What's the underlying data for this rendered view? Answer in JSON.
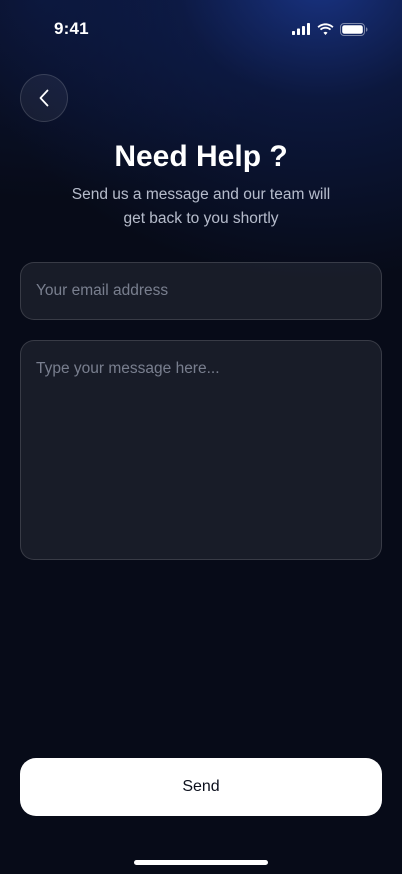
{
  "status_bar": {
    "time": "9:41"
  },
  "icons": {
    "back": "chevron-left-icon",
    "signal": "cellular-signal-icon",
    "wifi": "wifi-icon",
    "battery": "battery-icon"
  },
  "header": {
    "title": "Need Help ?",
    "subtitle": "Send us a message and our team will get back to you shortly"
  },
  "form": {
    "email_placeholder": "Your email address",
    "email_value": "",
    "message_placeholder": "Type your message here...",
    "message_value": "",
    "send_label": "Send"
  },
  "colors": {
    "background": "#070b18",
    "accent_glow": "#1c3a96",
    "button_bg": "#ffffff",
    "button_text": "#0b0f1c"
  }
}
